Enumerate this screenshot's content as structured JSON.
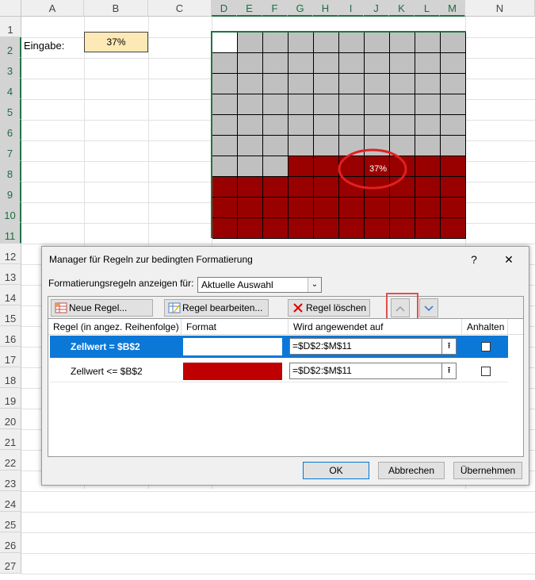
{
  "sheet": {
    "columns": [
      "A",
      "B",
      "C",
      "D",
      "E",
      "F",
      "G",
      "H",
      "I",
      "J",
      "K",
      "L",
      "M",
      "N"
    ],
    "rows": [
      "1",
      "2",
      "3",
      "4",
      "5",
      "6",
      "7",
      "8",
      "9",
      "10",
      "11",
      "12",
      "13",
      "14",
      "15",
      "16",
      "17",
      "18",
      "19",
      "20",
      "21",
      "22",
      "23",
      "24",
      "25",
      "26",
      "27"
    ],
    "label_eingabe": "Eingabe:",
    "input_value": "37%",
    "grid_value_label": "37%",
    "fill_ratio": 0.37
  },
  "dialog": {
    "title": "Manager für Regeln zur bedingten Formatierung",
    "help_icon": "?",
    "close_icon": "✕",
    "show_rules_label": "Formatierungsregeln anzeigen für:",
    "show_rules_value": "Aktuelle Auswahl",
    "toolbar": {
      "new_rule": "Neue Regel...",
      "edit_rule": "Regel bearbeiten...",
      "delete_rule": "Regel löschen",
      "move_up_icon": "chevron-up-icon",
      "move_down_icon": "chevron-down-icon"
    },
    "columns": {
      "rule": "Regel (in angez. Reihenfolge)",
      "format": "Format",
      "applies_to": "Wird angewendet auf",
      "stop": "Anhalten"
    },
    "rules": [
      {
        "rule": "Zellwert = $B$2",
        "format_color": "#ffffff",
        "applies_to": "=$D$2:$M$11",
        "selected": true
      },
      {
        "rule": "Zellwert <= $B$2",
        "format_color": "#c00000",
        "applies_to": "=$D$2:$M$11",
        "selected": false
      }
    ],
    "buttons": {
      "ok": "OK",
      "cancel": "Abbrechen",
      "apply": "Übernehmen"
    }
  },
  "colors": {
    "accent": "#217346",
    "selection": "#0b78d7",
    "dark_red": "#990000",
    "gray": "#c0c0c0",
    "highlight": "#e05050"
  }
}
